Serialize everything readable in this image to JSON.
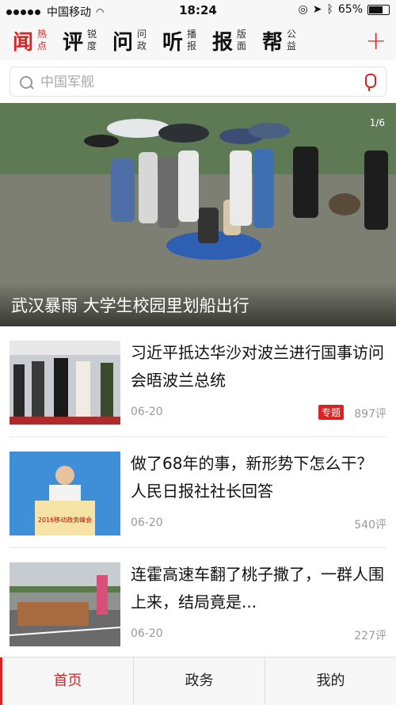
{
  "status": {
    "carrier": "中国移动",
    "time": "18:24",
    "battery": "65%"
  },
  "nav": {
    "items": [
      {
        "big": "闻",
        "small": "热点"
      },
      {
        "big": "评",
        "small": "锐度"
      },
      {
        "big": "问",
        "small": "问政"
      },
      {
        "big": "听",
        "small": "播报"
      },
      {
        "big": "报",
        "small": "版面"
      },
      {
        "big": "帮",
        "small": "公益"
      }
    ],
    "add": "+"
  },
  "search": {
    "placeholder": "中国军舰"
  },
  "hero": {
    "caption": "武汉暴雨 大学生校园里划船出行",
    "counter": "1/6"
  },
  "news": [
    {
      "title": "习近平抵达华沙对波兰进行国事访问 会晤波兰总统",
      "date": "06-20",
      "tag": "专题",
      "comments": "897评"
    },
    {
      "title": "做了68年的事，新形势下怎么干？人民日报社社长回答",
      "date": "06-20",
      "comments": "540评",
      "banner": "2016移动政务峰会"
    },
    {
      "title": "连霍高速车翻了桃子撒了，一群人围上来，结局竟是...",
      "date": "06-20",
      "comments": "227评"
    }
  ],
  "tabs": [
    "首页",
    "政务",
    "我的"
  ],
  "colors": {
    "accent": "#d22222"
  }
}
